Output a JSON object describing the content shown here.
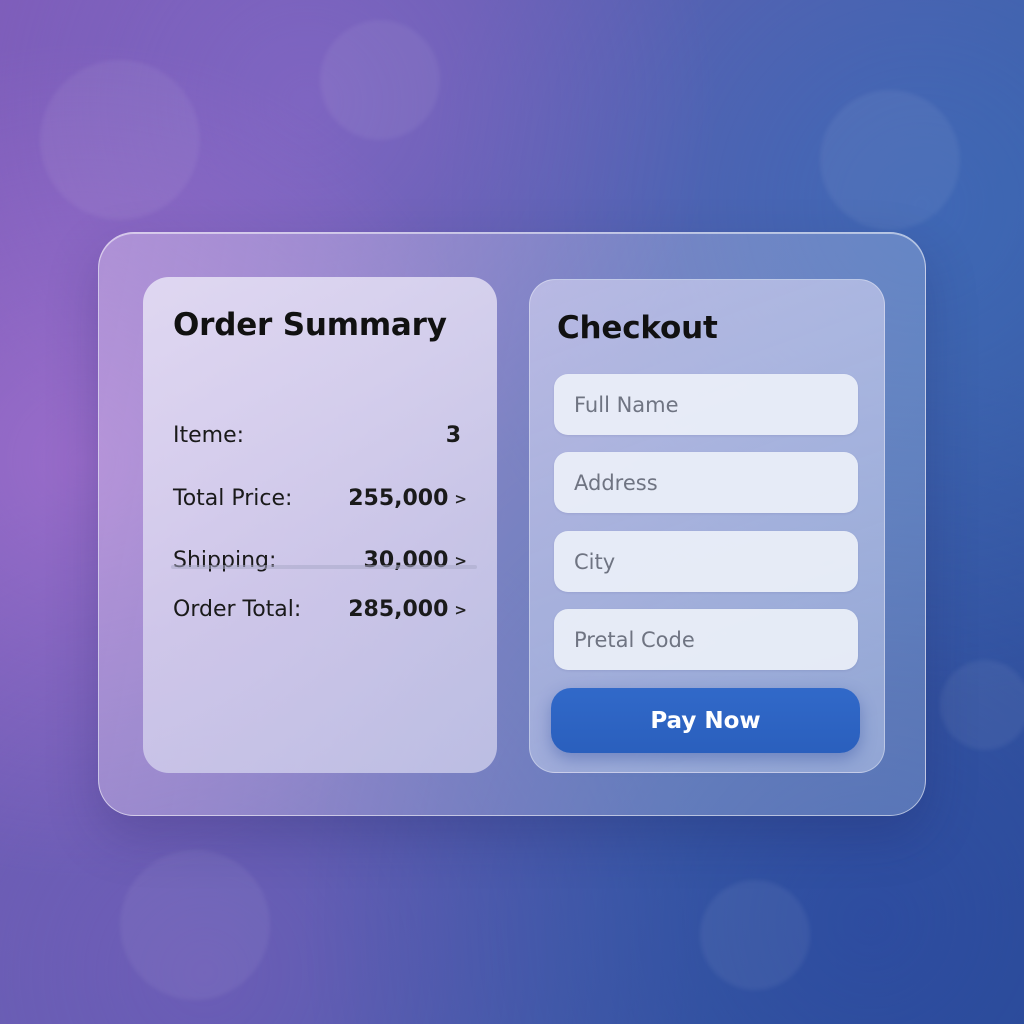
{
  "order_summary": {
    "title": "Order Summary",
    "items_label": "Iteme:",
    "items_value": "3",
    "total_price_label": "Total Price:",
    "total_price_value": "255,000",
    "shipping_label": "Shipping:",
    "shipping_value": "30,000",
    "order_total_label": "Order Total:",
    "order_total_value": "285,000",
    "chevron_glyph": ">"
  },
  "checkout": {
    "title": "Checkout",
    "full_name_placeholder": "Full Name",
    "address_placeholder": "Address",
    "city_placeholder": "City",
    "postal_code_placeholder": "Pretal Code",
    "pay_button_label": "Pay Now"
  },
  "colors": {
    "accent": "#2f66c6",
    "text": "#111111"
  }
}
